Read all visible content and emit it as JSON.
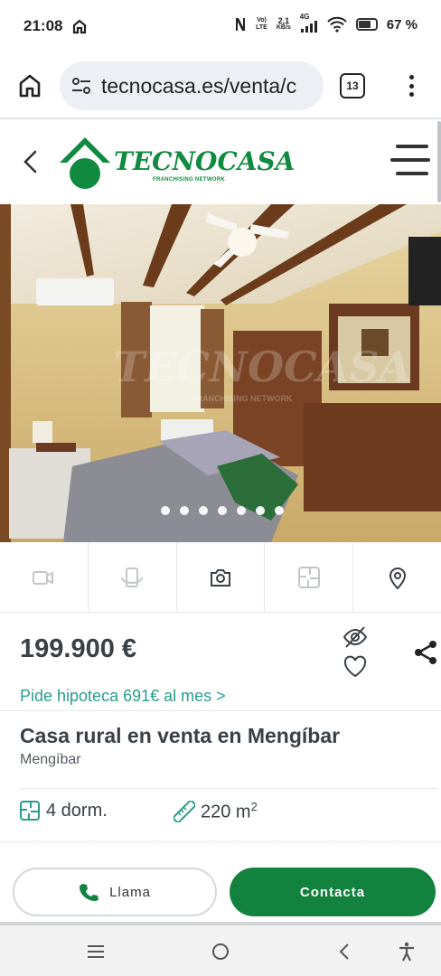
{
  "status_bar": {
    "time": "21:08",
    "network_top": "Vo)",
    "network_bottom": "LTE",
    "speed_top": "2,1",
    "speed_bottom": "KB/s",
    "signal_label": "4G",
    "battery": "67 %"
  },
  "browser": {
    "url": "tecnocasa.es/venta/c",
    "tab_count": "13"
  },
  "site": {
    "logo_title": "TECNOCASA",
    "logo_subtitle": "FRANCHISING NETWORK",
    "photo_watermark": "TECNOCASA",
    "photo_watermark_sub": "FRANCHISING NETWORK"
  },
  "gallery": {
    "dot_count": 7
  },
  "listing": {
    "price": "199.900 €",
    "mortgage": "Pide hipoteca 691€ al mes >",
    "title": "Casa rural en venta en Mengíbar",
    "location": "Mengíbar",
    "bedrooms": "4 dorm.",
    "area": "220 m",
    "area_sup": "2"
  },
  "actions": {
    "call": "Llama",
    "contact": "Contacta"
  },
  "colors": {
    "brand_green": "#14823f",
    "link_teal": "#2a9d8a"
  }
}
